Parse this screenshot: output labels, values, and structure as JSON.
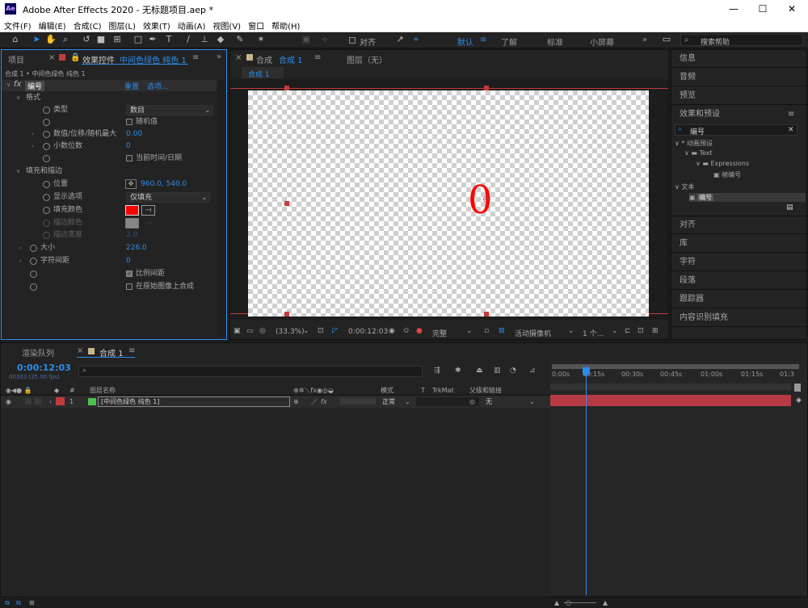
{
  "window": {
    "title": "Adobe After Effects 2020 - 无标题项目.aep *",
    "logo": "Ae",
    "minimize": "—",
    "maximize": "☐",
    "close": "✕"
  },
  "menu": [
    "文件(F)",
    "编辑(E)",
    "合成(C)",
    "图层(L)",
    "效果(T)",
    "动画(A)",
    "视图(V)",
    "窗口",
    "帮助(H)"
  ],
  "toolbar": {
    "snap_label": "对齐",
    "workspaces": [
      "默认",
      "了解",
      "标准",
      "小屏幕"
    ],
    "active_workspace": "默认",
    "search_help": "搜索帮助"
  },
  "left_panel": {
    "tab_project": "项目",
    "tab_effects": "效果控件",
    "tab_effects_layer": "中间色绿色 纯色 1",
    "breadcrumb": "合成 1 • 中间色绿色 纯色 1",
    "effect_name": "编号",
    "reset": "重置",
    "options": "选项...",
    "group_format": "格式",
    "group_fill": "填充和描边",
    "props": {
      "type_label": "类型",
      "type_value": "数目",
      "random_label": "随机值",
      "value_label": "数值/位移/随机最大",
      "value_value": "0.00",
      "decimals_label": "小数位数",
      "decimals_value": "0",
      "datetime_label": "当前时间/日期",
      "position_label": "位置",
      "position_value": "960.0, 540.0",
      "display_label": "显示选项",
      "display_value": "仅填充",
      "fill_color_label": "填充颜色",
      "stroke_color_label": "描边颜色",
      "stroke_width_label": "描边宽度",
      "stroke_width_value": "2.0",
      "size_label": "大小",
      "size_value": "226.0",
      "tracking_label": "字符间距",
      "tracking_value": "0",
      "proportional_label": "比例间距",
      "composite_label": "在原始图像上合成"
    }
  },
  "comp_panel": {
    "tab_label": "合成",
    "tab_comp": "合成 1",
    "tab_layer": "图层（无）",
    "sub_tab": "合成 1",
    "canvas_number": "0",
    "zoom": "(33.3%)",
    "timecode": "0:00:12:03",
    "resolution": "完整",
    "camera": "活动摄像机",
    "views": "1 个..."
  },
  "right_panel": {
    "items_top": [
      "信息",
      "音频",
      "预览"
    ],
    "effects_title": "效果和预设",
    "search_value": "编号",
    "tree": {
      "anim_presets": "* 动画预设",
      "text": "Text",
      "expressions": "Expressions",
      "preset_item": "帧编号",
      "category_text": "文本",
      "effect_item": "编号"
    },
    "items_bottom": [
      "对齐",
      "库",
      "字符",
      "段落",
      "跟踪器",
      "内容识别填充"
    ]
  },
  "timeline": {
    "tab_render": "渲染队列",
    "tab_comp": "合成 1",
    "timecode": "0:00:12:03",
    "frame_info": "00303 (25.00 fps)",
    "col_layer_name": "图层名称",
    "col_mode": "模式",
    "col_t": "T",
    "col_trkmat": "TrkMat",
    "col_parent": "父级和链接",
    "layer_num": "1",
    "layer_name": "[中间色绿色 纯色 1]",
    "layer_mode": "正常",
    "layer_parent": "无",
    "ruler": [
      "0:00s",
      "00:15s",
      "00:30s",
      "00:45s",
      "01:00s",
      "01:15s",
      "01:3"
    ]
  },
  "colors": {
    "accent": "#2d8ceb",
    "fill_red": "#ff0000",
    "layer_bar": "#b53a44",
    "layer_label_green": "#4bc34b",
    "layer_label_red": "#c33c3c"
  }
}
